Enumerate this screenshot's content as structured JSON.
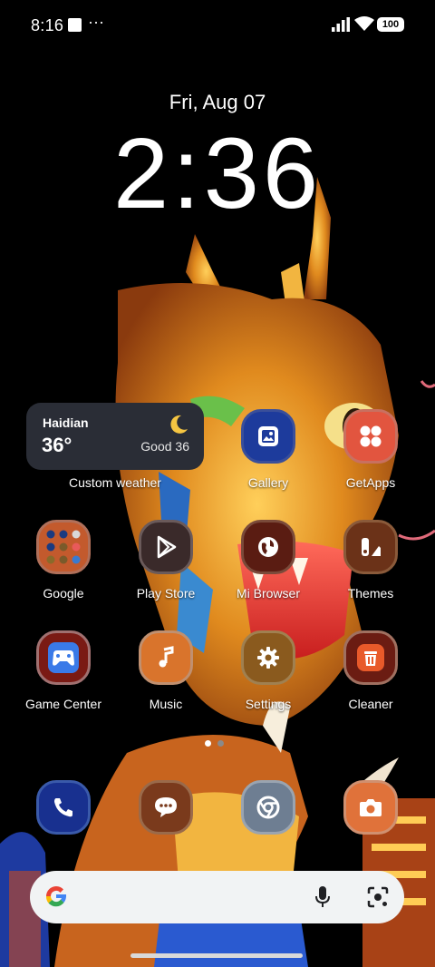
{
  "status_bar": {
    "time": "8:16",
    "more": "···",
    "battery": "100"
  },
  "lockscreen": {
    "date": "Fri, Aug 07",
    "time": "2:36"
  },
  "weather_widget": {
    "city": "Haidian",
    "temperature": "36°",
    "air_quality": "Good 36",
    "label": "Custom weather"
  },
  "apps": {
    "gallery": "Gallery",
    "getapps": "GetApps",
    "google": "Google",
    "play_store": "Play Store",
    "mi_browser": "Mi Browser",
    "themes": "Themes",
    "game_center": "Game Center",
    "music": "Music",
    "settings": "Settings",
    "cleaner": "Cleaner"
  },
  "page_indicator": {
    "pages": 2,
    "current": 1
  },
  "dock": [
    "phone-icon",
    "messages-icon",
    "chrome-icon",
    "camera-icon"
  ],
  "colors": {
    "gallery": "#1d3b9c",
    "getapps": "#e2553f",
    "google_folder": "#c35a2d",
    "play_store": "#3a2a2a",
    "mi_browser": "#5a1c12",
    "themes": "#6b3218",
    "game_center": "#7a1a14",
    "music": "#d9742c",
    "settings": "#8a5a1e",
    "cleaner": "#6b1c12",
    "phone": "#18308f",
    "messages": "#7a3a1c",
    "chrome": "#6e7e92",
    "camera": "#e0723a"
  }
}
